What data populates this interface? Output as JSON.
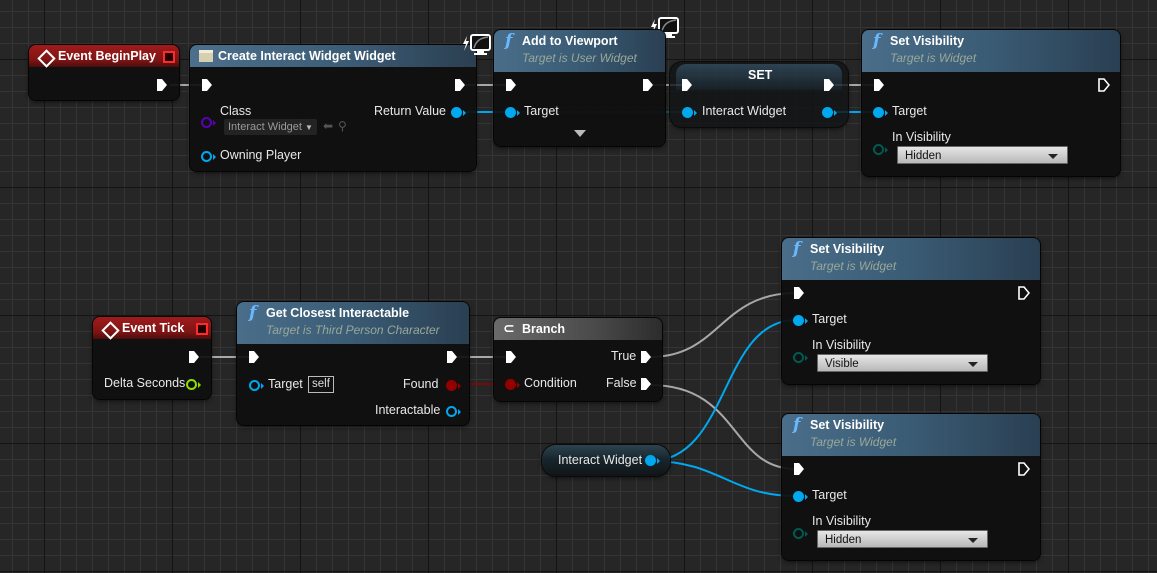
{
  "graph": {
    "begin_play": {
      "title": "Event BeginPlay"
    },
    "create_widget": {
      "title": "Create Interact Widget Widget",
      "class_label": "Class",
      "class_value": "Interact Widget",
      "owning_player_label": "Owning Player",
      "return_value_label": "Return Value"
    },
    "add_to_viewport": {
      "title": "Add to Viewport",
      "subtitle": "Target is User Widget",
      "target_label": "Target"
    },
    "set_node": {
      "title": "SET",
      "var_label": "Interact Widget"
    },
    "set_visibility_1": {
      "title": "Set Visibility",
      "subtitle": "Target is Widget",
      "target_label": "Target",
      "visibility_label": "In Visibility",
      "visibility_value": "Hidden"
    },
    "event_tick": {
      "title": "Event Tick",
      "delta_label": "Delta Seconds"
    },
    "get_closest": {
      "title": "Get Closest Interactable",
      "subtitle": "Target is Third Person Character",
      "target_label": "Target",
      "target_default": "self",
      "found_label": "Found",
      "interactable_label": "Interactable"
    },
    "branch": {
      "title": "Branch",
      "condition_label": "Condition",
      "true_label": "True",
      "false_label": "False"
    },
    "get_var": {
      "label": "Interact Widget"
    },
    "set_visibility_2": {
      "title": "Set Visibility",
      "subtitle": "Target is Widget",
      "target_label": "Target",
      "visibility_label": "In Visibility",
      "visibility_value": "Visible"
    },
    "set_visibility_3": {
      "title": "Set Visibility",
      "subtitle": "Target is Widget",
      "target_label": "Target",
      "visibility_label": "In Visibility",
      "visibility_value": "Hidden"
    }
  },
  "colors": {
    "exec_wire": "#c8c8c8",
    "object_pin": "#00a8f0",
    "bool_pin": "#940000",
    "event_header": "#a01b1b",
    "function_header": "#4a6e8a"
  }
}
